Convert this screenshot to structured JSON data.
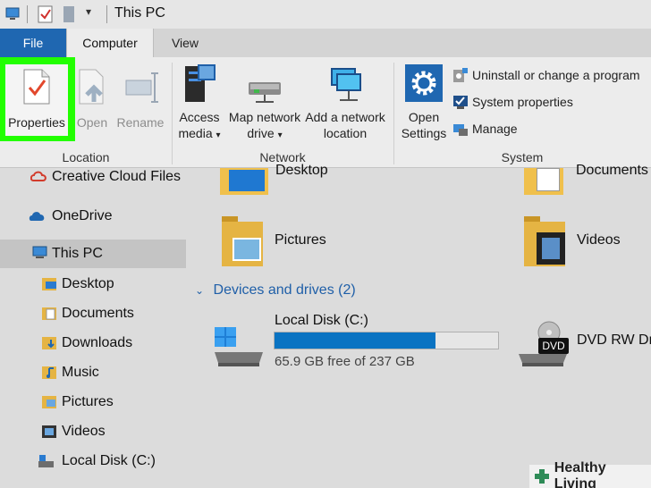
{
  "window": {
    "title": "This PC"
  },
  "tabs": [
    {
      "label": "File"
    },
    {
      "label": "Computer"
    },
    {
      "label": "View"
    }
  ],
  "ribbon": {
    "location": {
      "group_label": "Location",
      "properties": "Properties",
      "open": "Open",
      "rename": "Rename"
    },
    "network": {
      "group_label": "Network",
      "access_media_1": "Access",
      "access_media_2": "media",
      "map_drive_1": "Map network",
      "map_drive_2": "drive",
      "add_location_1": "Add a network",
      "add_location_2": "location"
    },
    "system": {
      "group_label": "System",
      "open_settings_1": "Open",
      "open_settings_2": "Settings",
      "uninstall": "Uninstall or change a program",
      "system_properties": "System properties",
      "manage": "Manage"
    }
  },
  "sidebar": {
    "items": [
      {
        "label": "Creative Cloud Files"
      },
      {
        "label": "OneDrive"
      },
      {
        "label": "This PC"
      },
      {
        "label": "Desktop"
      },
      {
        "label": "Documents"
      },
      {
        "label": "Downloads"
      },
      {
        "label": "Music"
      },
      {
        "label": "Pictures"
      },
      {
        "label": "Videos"
      },
      {
        "label": "Local Disk (C:)"
      }
    ]
  },
  "main": {
    "folders": [
      {
        "label": "Desktop"
      },
      {
        "label": "Documents"
      },
      {
        "label": "Pictures"
      },
      {
        "label": "Videos"
      }
    ],
    "devices_header": "Devices and drives (2)",
    "drives": [
      {
        "label": "Local Disk (C:)",
        "free_text": "65.9 GB free of 237 GB",
        "used_fraction": 0.72
      },
      {
        "label": "DVD RW Dr",
        "badge": "DVD"
      }
    ]
  },
  "watermark": {
    "text": "Healthy Living"
  },
  "colors": {
    "accent": "#1f67b1",
    "highlight": "#22ff00",
    "progress": "#0a73c2",
    "folder": "#f0c04c"
  }
}
